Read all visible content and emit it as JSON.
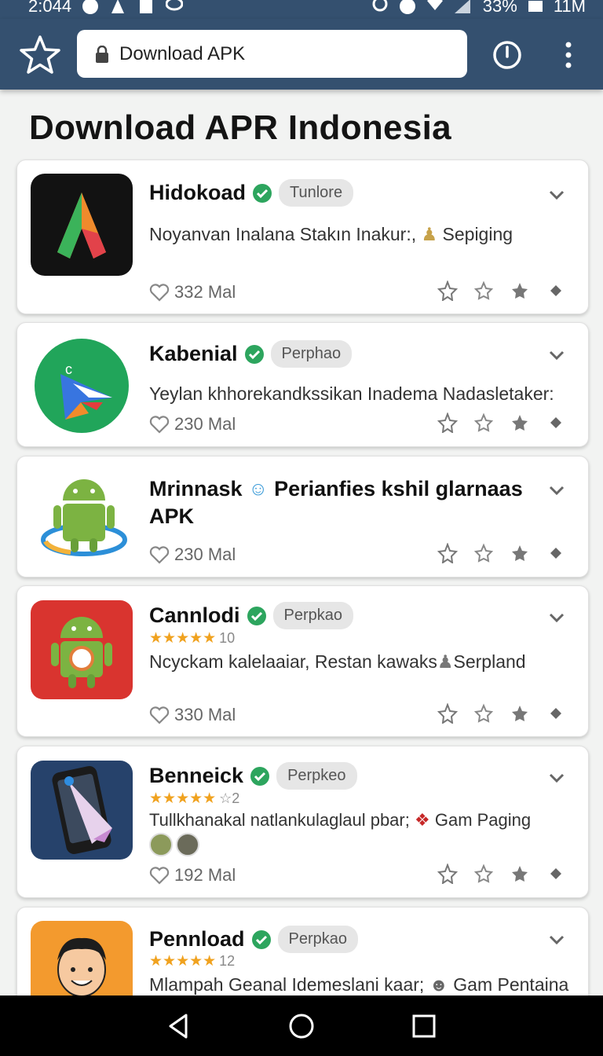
{
  "status_bar": {
    "time": "2:044",
    "battery": "33%",
    "label_right": "11M"
  },
  "toolbar": {
    "url_text": "Download APK"
  },
  "page_title": "Download APR Indonesia",
  "apps": [
    {
      "name": "Hidokoad",
      "tag": "Tunlore",
      "description": "Noyanvan Inalana Stakın Inakur:,",
      "description_suffix": "Sepiging",
      "likes": "332 Mal"
    },
    {
      "name": "Kabenial",
      "tag": "Perphao",
      "description": "Yeylan khhorekandkssikan Inadema Nadasletaker:",
      "likes": "230 Mal"
    },
    {
      "name": "Mrinnask",
      "title_extra": "Perianfies kshil glarnaas",
      "title_line2": "APK",
      "likes": "230 Mal"
    },
    {
      "name": "Cannlodi",
      "tag": "Perpkao",
      "stars": "★★★★★",
      "rating": "10",
      "description": "Ncyckam kalelaaiar, Restan kawaks",
      "description_suffix": "Serpland",
      "likes": "330 Mal"
    },
    {
      "name": "Benneick",
      "tag": "Perpkeo",
      "stars": "★★★★★",
      "rating": "☆2",
      "description": "Tullkhanakal natlankulaglaul pbar;",
      "description_suffix": "Gam Paging",
      "likes": "192 Mal"
    },
    {
      "name": "Pennload",
      "tag": "Perpkao",
      "stars": "★★★★★",
      "rating": "12",
      "description": "Mlampah Geanal Idemeslani kaar;",
      "description_suffix": "Gam Pentaina"
    }
  ],
  "colors": {
    "toolbar": "#34506f",
    "verified": "#2da55e",
    "star": "#f0a21f"
  }
}
